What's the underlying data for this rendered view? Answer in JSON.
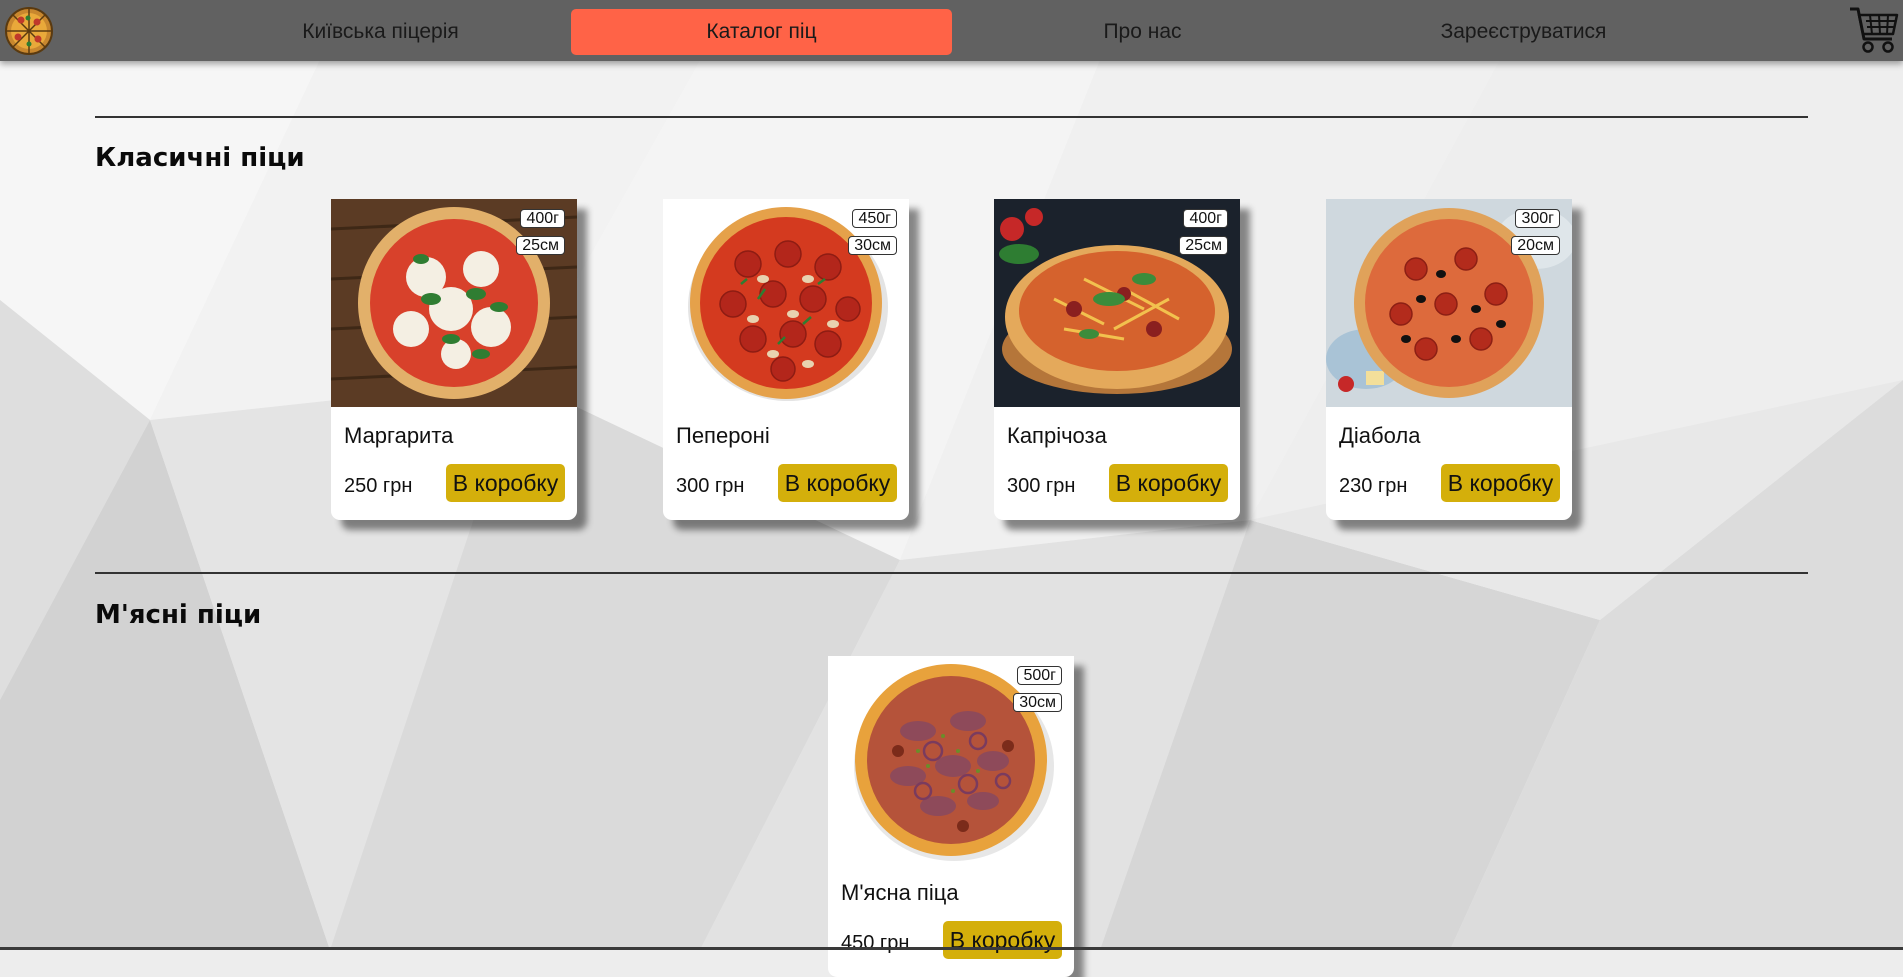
{
  "nav": {
    "items": [
      {
        "label": "Київська піцерія",
        "active": false
      },
      {
        "label": "Каталог піц",
        "active": true
      },
      {
        "label": "Про нас",
        "active": false
      },
      {
        "label": "Зареєструватися",
        "active": false
      }
    ],
    "logo_icon": "pizza-logo-icon",
    "cart_icon": "cart-icon"
  },
  "colors": {
    "navbar": "#616161",
    "active_tab": "#ff6347",
    "cart_button": "#d4af0b"
  },
  "sections": [
    {
      "title": "Класичні піци",
      "pizzas": [
        {
          "name": "Маргарита",
          "price": "250 грн",
          "weight": "400г",
          "size": "25см",
          "button": "В коробку"
        },
        {
          "name": "Пепероні",
          "price": "300 грн",
          "weight": "450г",
          "size": "30см",
          "button": "В коробку"
        },
        {
          "name": "Капрічоза",
          "price": "300 грн",
          "weight": "400г",
          "size": "25см",
          "button": "В коробку"
        },
        {
          "name": "Діабола",
          "price": "230 грн",
          "weight": "300г",
          "size": "20см",
          "button": "В коробку"
        }
      ]
    },
    {
      "title": "М'ясні піци",
      "pizzas": [
        {
          "name": "М'ясна піца",
          "price": "450 грн",
          "weight": "500г",
          "size": "30см",
          "button": "В коробку"
        }
      ]
    }
  ]
}
